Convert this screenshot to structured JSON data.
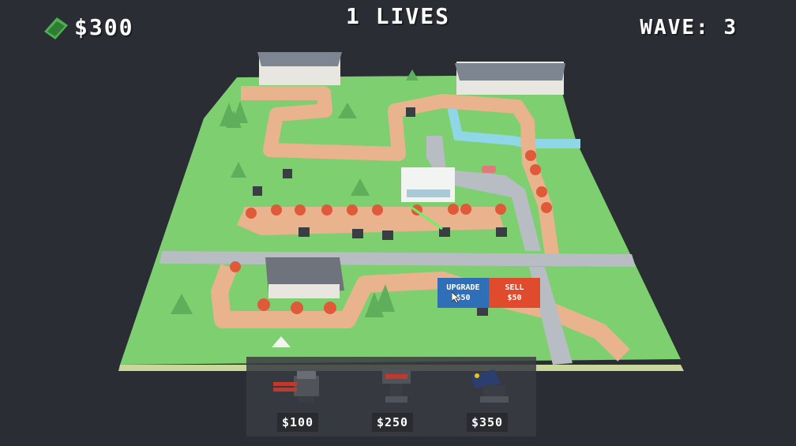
{
  "hud": {
    "money": "$300",
    "money_icon": "cash-icon",
    "lives": "1 LIVES",
    "wave": "WAVE: 3"
  },
  "context_menu": {
    "upgrade_label": "UPGRADE",
    "upgrade_cost": "$50",
    "sell_label": "SELL",
    "sell_cost": "$50"
  },
  "shop": {
    "items": [
      {
        "name": "standard-turret",
        "price": "$100"
      },
      {
        "name": "missile-launcher",
        "price": "$250"
      },
      {
        "name": "laser-beamer",
        "price": "$350"
      }
    ]
  },
  "colors": {
    "background": "#2b2d35",
    "grass": "#7ccf6e",
    "path": "#e8b38c",
    "road": "#b9bcc4",
    "enemy": "#e05a3a",
    "upgrade": "#2f6fb8",
    "sell": "#e04b2e"
  }
}
